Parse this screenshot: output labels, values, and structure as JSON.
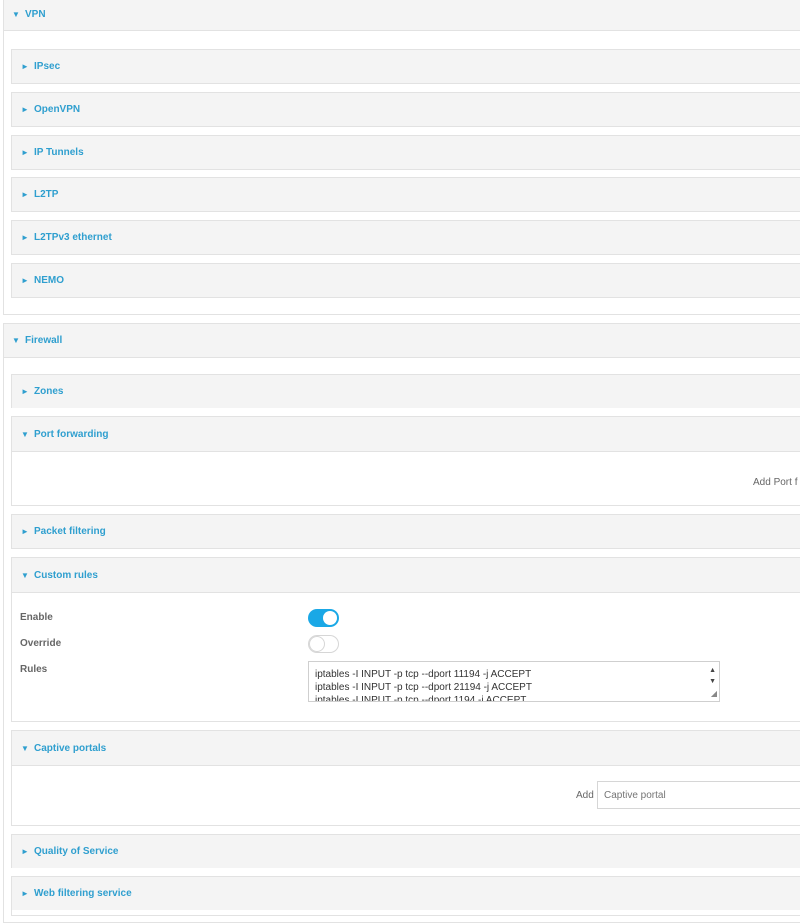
{
  "vpn": {
    "title": "VPN",
    "arrow": "▼",
    "items": [
      {
        "label": "IPsec",
        "arrow": "►"
      },
      {
        "label": "OpenVPN",
        "arrow": "►"
      },
      {
        "label": "IP Tunnels",
        "arrow": "►"
      },
      {
        "label": "L2TP",
        "arrow": "►"
      },
      {
        "label": "L2TPv3 ethernet",
        "arrow": "►"
      },
      {
        "label": "NEMO",
        "arrow": "►"
      }
    ]
  },
  "firewall": {
    "title": "Firewall",
    "arrow": "▼",
    "zones": {
      "label": "Zones",
      "arrow": "►"
    },
    "port_forwarding": {
      "label": "Port forwarding",
      "arrow": "▼",
      "add_text": "Add Port f"
    },
    "packet_filtering": {
      "label": "Packet filtering",
      "arrow": "►"
    },
    "custom_rules": {
      "label": "Custom rules",
      "arrow": "▼",
      "enable_label": "Enable",
      "enable_state": true,
      "override_label": "Override",
      "override_state": false,
      "rules_label": "Rules",
      "rules_lines": [
        "iptables -I INPUT -p tcp --dport 11194 -j ACCEPT",
        "iptables -I INPUT -p tcp --dport 21194 -j ACCEPT",
        "iptables -I INPUT -p tcp --dport 1194 -j ACCEPT"
      ]
    },
    "captive_portals": {
      "label": "Captive portals",
      "arrow": "▼",
      "add_label": "Add",
      "add_input_placeholder": "Captive portal"
    },
    "quality_of_service": {
      "label": "Quality of Service",
      "arrow": "►"
    },
    "web_filtering": {
      "label": "Web filtering service",
      "arrow": "►"
    }
  },
  "colors": {
    "accent": "#2f9fcf",
    "toggle_on": "#1aa8e6",
    "header_bg": "#f4f4f4"
  }
}
